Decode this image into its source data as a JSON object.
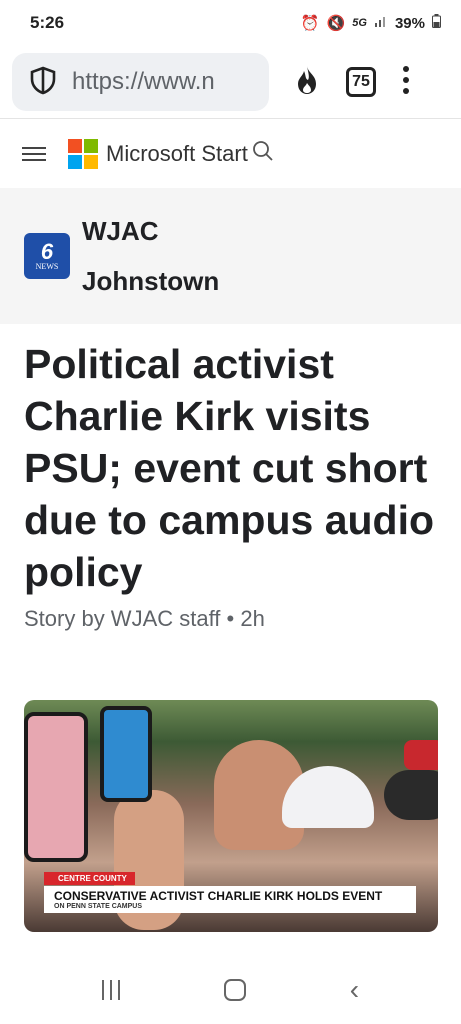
{
  "status": {
    "time": "5:26",
    "network": "5G",
    "battery": "39%",
    "icons": [
      "alarm-icon",
      "mute-icon",
      "signal-icon",
      "battery-icon"
    ]
  },
  "browser": {
    "url": "https://www.n",
    "tab_count": "75",
    "icons": [
      "shield-icon",
      "flame-icon",
      "tab-switcher-icon",
      "menu-dots-icon"
    ]
  },
  "site": {
    "brand": "Microsoft Start",
    "logo_colors": [
      "#f25022",
      "#7fba00",
      "#00a4ef",
      "#ffb900"
    ]
  },
  "publisher": {
    "name_line1": "WJAC",
    "name_line2": "Johnstown",
    "logo_text_top": "6",
    "logo_text_bottom": "NEWS",
    "logo_color": "#1f4fa8"
  },
  "article": {
    "headline": "Political activist Charlie Kirk visits PSU; event cut short due to campus audio policy",
    "byline": "Story by WJAC staff • 2h"
  },
  "hero": {
    "tag": "CENTRE COUNTY",
    "main": "CONSERVATIVE ACTIVIST CHARLIE KIRK HOLDS EVENT",
    "sub": "ON PENN STATE CAMPUS",
    "accent": "#d8262b"
  }
}
